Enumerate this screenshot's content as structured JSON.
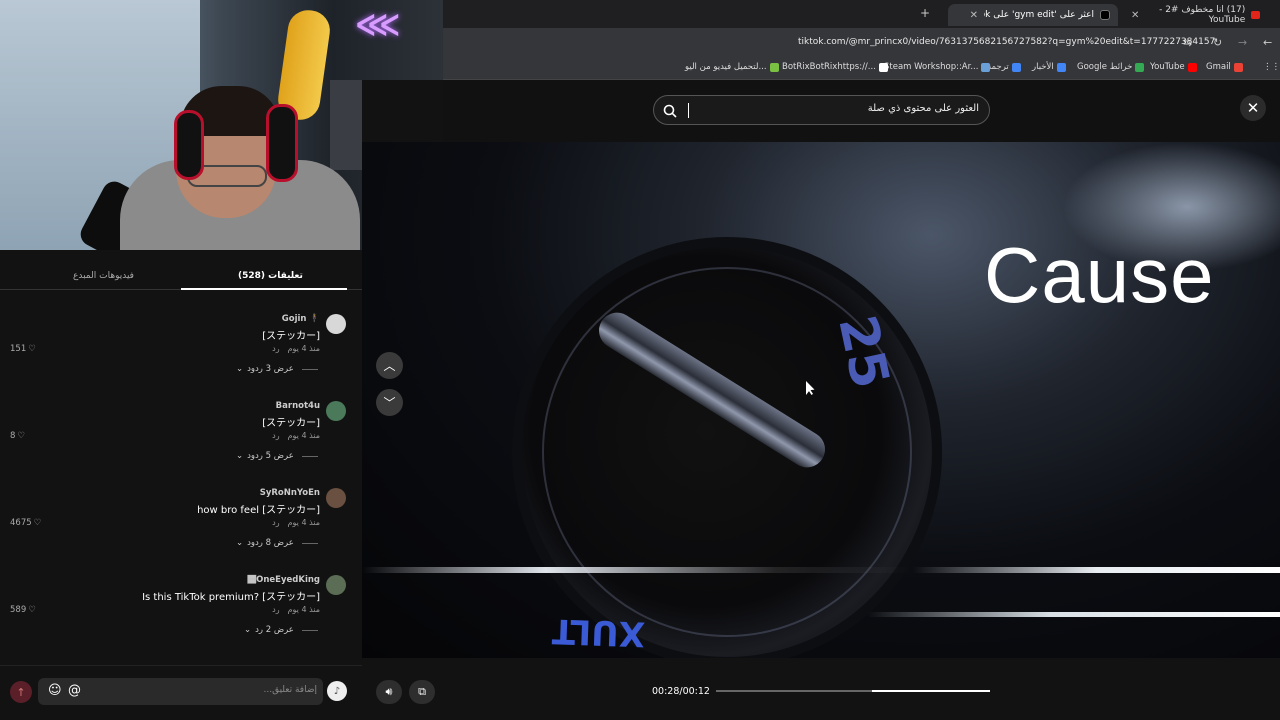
{
  "browser": {
    "tabs": [
      {
        "title": "(17) انا مخطوف #2 - YouTube",
        "favicon": "youtube-icon"
      },
      {
        "title": "اعثر على 'gym edit' على TikTok",
        "favicon": "tiktok-icon"
      }
    ],
    "new_tab": "+",
    "url": "tiktok.com/@mr_princx0/video/7631375682156727582?q=gym%20edit&t=1777227384157",
    "bookmarks": [
      {
        "label": "Gmail",
        "color": "#ea4335"
      },
      {
        "label": "YouTube",
        "color": "#ff0000"
      },
      {
        "label": "Google خرائط",
        "color": "#34a853"
      },
      {
        "label": "الأخبار",
        "color": "#4285f4"
      },
      {
        "label": "ترجمة",
        "color": "#4285f4"
      },
      {
        "label": "Steam Workshop::Ar...",
        "color": "#1b2838"
      },
      {
        "label": "BotRixBotRixhttps://...",
        "color": "#ffffff"
      },
      {
        "label": "لتحميل فيديو من اليو...",
        "color": "#7ac143"
      }
    ]
  },
  "search": {
    "placeholder": "العثور على محتوى ذي صلة"
  },
  "video": {
    "overlay_text": "Cause",
    "plate_number": "25",
    "plate_brand": "XULT"
  },
  "player": {
    "time": "00:28/00:12",
    "progress": 0.57
  },
  "panel": {
    "tab_comments": "تعليقات (528)",
    "tab_creator_videos": "فيديوهات المبدع"
  },
  "comments": [
    {
      "user": "Gojin 🕴",
      "text": "[ステッカー]",
      "age": "منذ 4 يوم",
      "reply": "رد",
      "likes": "151",
      "replies": "عرض 3 ردود",
      "avatar_color": "#d8d8d8"
    },
    {
      "user": "Barnot4u",
      "text": "[ステッカー]",
      "age": "منذ 4 يوم",
      "reply": "رد",
      "likes": "8",
      "replies": "عرض 5 ردود",
      "avatar_color": "#4a7a5a"
    },
    {
      "user": "SyRoNnYoEn",
      "text": "how bro feel [ステッカー]",
      "age": "منذ 4 يوم",
      "reply": "رد",
      "likes": "4675",
      "replies": "عرض 8 ردود",
      "avatar_color": "#6a5040"
    },
    {
      "user": "🏾OneEyedKing",
      "text": "Is this TikTok premium? [ステッカー]",
      "age": "منذ 4 يوم",
      "reply": "رد",
      "likes": "589",
      "replies": "عرض 2 رد",
      "avatar_color": "#5b6e55"
    }
  ],
  "composer": {
    "placeholder": "إضافة تعليق..."
  },
  "colors": {
    "background": "#121212",
    "accent": "#fe2c55"
  }
}
